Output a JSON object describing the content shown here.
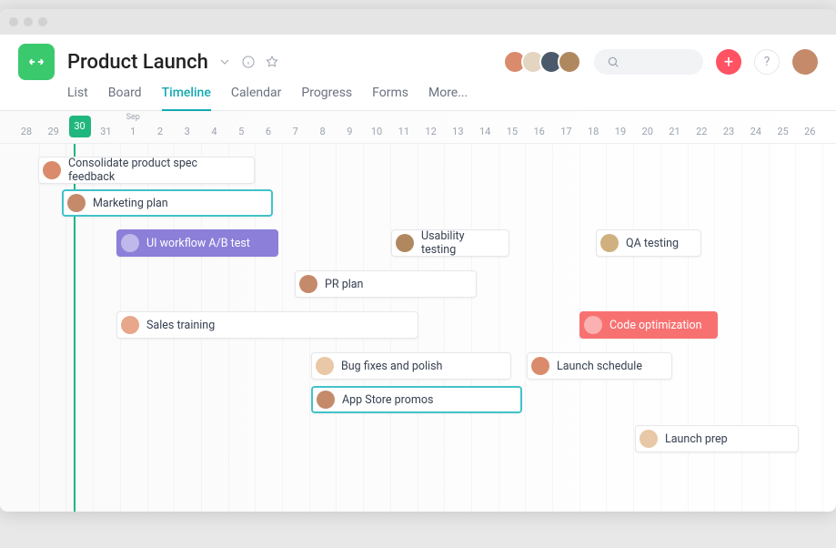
{
  "project": {
    "title": "Product Launch"
  },
  "tabs": {
    "list": "List",
    "board": "Board",
    "timeline": "Timeline",
    "calendar": "Calendar",
    "progress": "Progress",
    "forms": "Forms",
    "more": "More..."
  },
  "dates": {
    "month": "Sep",
    "days": [
      "28",
      "29",
      "30",
      "31",
      "1",
      "2",
      "3",
      "4",
      "5",
      "6",
      "7",
      "8",
      "9",
      "10",
      "11",
      "12",
      "13",
      "14",
      "15",
      "16",
      "17",
      "18",
      "19",
      "20",
      "21",
      "22",
      "23",
      "24",
      "25",
      "26"
    ],
    "today": "30"
  },
  "tasks": {
    "t1": "Consolidate product spec feedback",
    "t2": "Marketing plan",
    "t3": "UI workflow A/B test",
    "t4": "Usability testing",
    "t5": "QA testing",
    "t6": "PR plan",
    "t7": "Sales training",
    "t8": "Code optimization",
    "t9": "Bug fixes and polish",
    "t10": "Launch schedule",
    "t11": "App Store promos",
    "t12": "Launch prep"
  },
  "colors": {
    "accent": "#14aaaf",
    "today": "#1fb77d",
    "add": "#ff5263"
  }
}
